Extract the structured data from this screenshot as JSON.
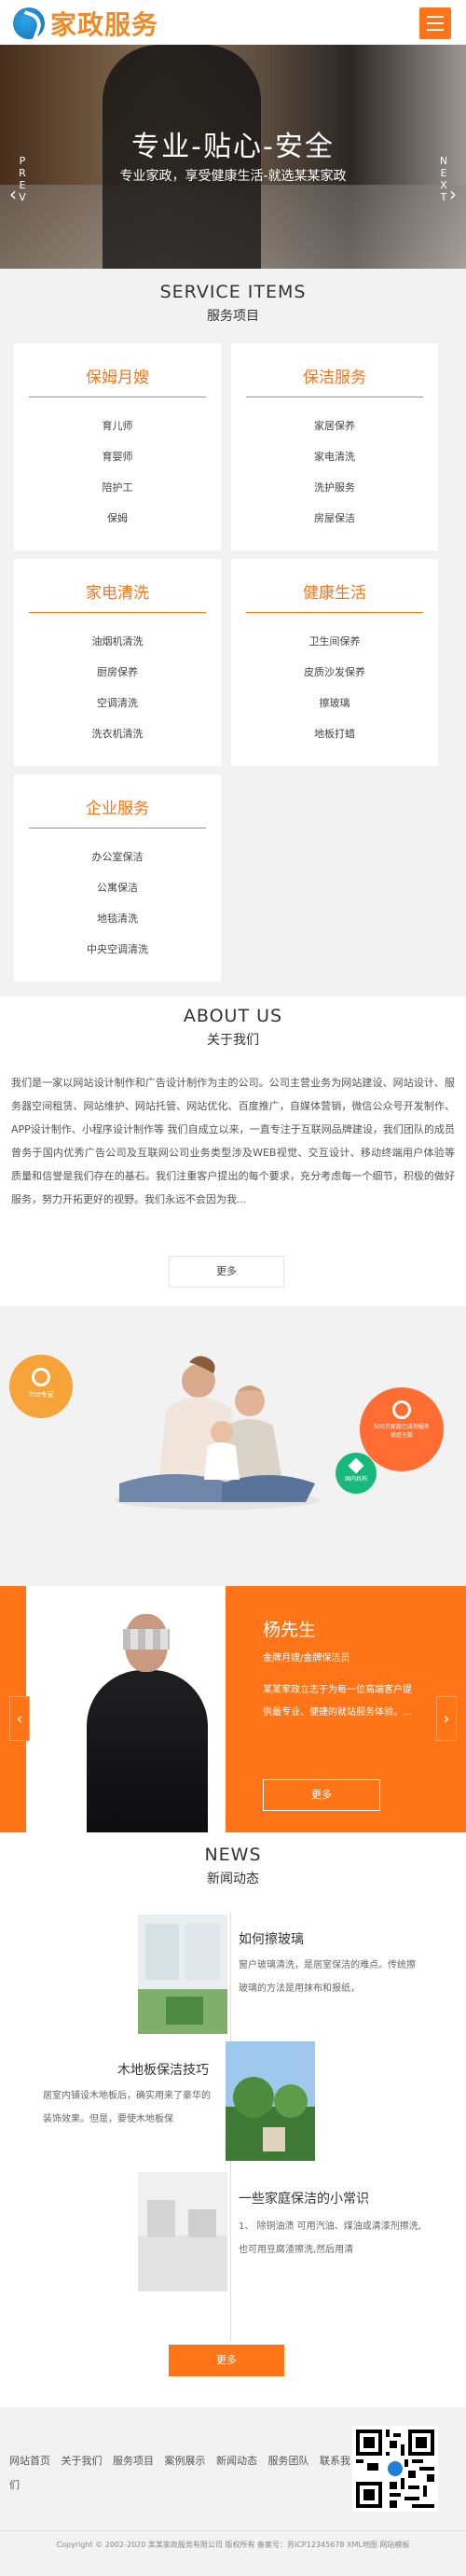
{
  "header": {
    "logo_text": "家政服务",
    "menu_icon": "menu-icon"
  },
  "banner": {
    "title": "专业-贴心-安全",
    "subtitle": "专业家政，享受健康生活-就选某某家政",
    "prev_label": "PREV",
    "next_label": "NEXT"
  },
  "services": {
    "title_en": "SERVICE ITEMS",
    "title_cn": "服务项目",
    "cards": [
      {
        "title": "保姆月嫂",
        "items": [
          "育儿师",
          "育婴师",
          "陪护工",
          "保姆"
        ]
      },
      {
        "title": "保洁服务",
        "items": [
          "家居保养",
          "家电清洗",
          "洗护服务",
          "房屋保洁"
        ]
      },
      {
        "title": "家电清洗",
        "items": [
          "油烟机清洗",
          "厨房保养",
          "空调清洗",
          "洗衣机清洗"
        ]
      },
      {
        "title": "健康生活",
        "items": [
          "卫生间保养",
          "皮质沙发保养",
          "擦玻璃",
          "地板打蜡"
        ]
      },
      {
        "title": "企业服务",
        "items": [
          "办公室保洁",
          "公寓保洁",
          "地毯清洗",
          "中央空调清洗"
        ]
      }
    ]
  },
  "about": {
    "title_en": "ABOUT US",
    "title_cn": "关于我们",
    "text": "我们是一家以网站设计制作和广告设计制作为主的公司。公司主营业务为网站建设、网站设计、服务器空间租赁、网站维护、网站托管、网站优化、百度推广，自媒体营销，微信公众号开发制作、APP设计制作、小程序设计制作等 我们自成立以来，一直专注于互联网品牌建设，我们团队的成员曾务于国内优秀广告公司及互联网公司业务类型涉及WEB视觉、交互设计、移动终端用户体验等质量和信誉是我们存在的基石。我们注重客户提出的每个要求，充分考虑每一个细节，积极的做好服务，努力开拓更好的视野。我们永远不会因为我...",
    "more_label": "更多",
    "badge_left": "700专家",
    "badge_right": "500万家庭已成功服务家庭无数",
    "badge_green": "国内机构"
  },
  "team": {
    "name": "杨先生",
    "role": "金牌月嫂/金牌保洁员",
    "desc": "某某家政立志于为每一位高端客户提供最专业、便捷的就站服务体验。...",
    "more_label": "更多"
  },
  "news": {
    "title_en": "NEWS",
    "title_cn": "新闻动态",
    "items": [
      {
        "title": "如何擦玻璃",
        "text": "窗户玻璃清洗，是居室保洁的难点。传统擦玻璃的方法是用抹布和报纸，"
      },
      {
        "title": "木地板保洁技巧",
        "text": "居室内铺设木地板后，确实用来了豪华的装饰效果。但是，要使木地板保"
      },
      {
        "title": "一些家庭保洁的小常识",
        "text": "1、 除铜油渍 可用汽油、煤油或清漆剂擦洗,也可用豆腐渣擦洗,然后用清"
      }
    ],
    "more_label": "更多"
  },
  "footer": {
    "nav": [
      "网站首页",
      "关于我们",
      "服务项目",
      "案例展示",
      "新闻动态",
      "服务团队",
      "联系我们"
    ],
    "copyright": "Copyright © 2002-2020 某某家政服务有限公司 版权所有 备案号：苏ICP12345678 XML地图 网站模板"
  },
  "colors": {
    "accent": "#ff7417",
    "logo": "#f08a24",
    "green": "#18b77c",
    "red": "#ff6d33",
    "yellow": "#f6a33a"
  }
}
